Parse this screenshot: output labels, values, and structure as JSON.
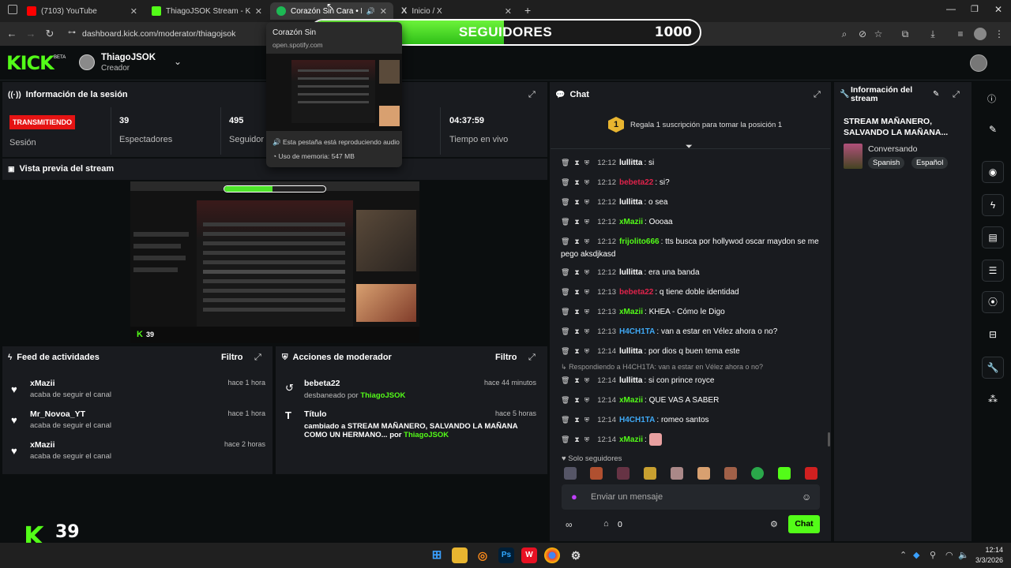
{
  "browser": {
    "tabs": [
      {
        "label": "(7103) YouTube",
        "color": "#ff0000"
      },
      {
        "label": "ThiagoJSOK Stream - Kick Dash",
        "color": "#53fc18"
      },
      {
        "label": "Corazón Sin Cara • Prince R",
        "color": "#1db954"
      },
      {
        "label": "Inicio / X",
        "color": "#ffffff"
      }
    ],
    "url": "dashboard.kick.com/moderator/thiagojsok"
  },
  "tab_preview": {
    "title": "Corazón Sin",
    "site": "open.spotify.com",
    "audio_note": "Esta pestaña está reproduciendo audio",
    "memory": "Uso de memoria: 547 MB"
  },
  "follower_goal": {
    "current": "495",
    "label": "SEGUIDORES",
    "target": "1000",
    "progress": 0.495
  },
  "header": {
    "logo": "KICK",
    "beta": "BETA",
    "username": "ThiagoJSOK",
    "role": "Creador"
  },
  "session": {
    "title": "Información de la sesión",
    "status": "TRANSMITIENDO",
    "status_label": "Sesión",
    "viewers_value": "39",
    "viewers_label": "Espectadores",
    "followers_value": "495",
    "followers_label": "Seguidor",
    "uptime_value": "04:37:59",
    "uptime_label": "Tiempo en vivo"
  },
  "preview": {
    "title": "Vista previa del stream"
  },
  "activity": {
    "title": "Feed de actividades",
    "filter": "Filtro",
    "items": [
      {
        "name": "xMazii",
        "sub": "acaba de seguir el canal",
        "time": "hace 1 hora"
      },
      {
        "name": "Mr_Novoa_YT",
        "sub": "acaba de seguir el canal",
        "time": "hace 1 hora"
      },
      {
        "name": "xMazii",
        "sub": "acaba de seguir el canal",
        "time": "hace 2 horas"
      }
    ]
  },
  "mod_actions": {
    "title": "Acciones de moderador",
    "filter": "Filtro",
    "items": [
      {
        "name": "bebeta22",
        "action": "desbaneado por",
        "by": "ThiagoJSOK",
        "time": "hace 44 minutos"
      },
      {
        "name": "Título",
        "action": "cambiado a STREAM MAÑANERO, SALVANDO LA MAÑANA COMO UN HERMANO... por",
        "by": "ThiagoJSOK",
        "time": "hace 5 horas"
      }
    ]
  },
  "chat": {
    "title": "Chat",
    "sub_promo": "Regala 1 suscripción para tomar la posición 1",
    "sub_rank": "1",
    "messages": [
      {
        "time": "12:12",
        "user": "lullitta",
        "color": "#ffffff",
        "text": "si"
      },
      {
        "time": "12:12",
        "user": "bebeta22",
        "color": "#e0234b",
        "text": "si?"
      },
      {
        "time": "12:12",
        "user": "lullitta",
        "color": "#ffffff",
        "text": "o sea"
      },
      {
        "time": "12:12",
        "user": "xMazii",
        "color": "#53fc18",
        "text": "Oooaa"
      },
      {
        "time": "12:12",
        "user": "frijolito666",
        "color": "#53fc18",
        "text": "tts busca por hollywod oscar maydon se me pego aksdjkasd"
      },
      {
        "time": "12:12",
        "user": "lullitta",
        "color": "#ffffff",
        "text": "era una banda"
      },
      {
        "time": "12:13",
        "user": "bebeta22",
        "color": "#e0234b",
        "text": "q tiene doble identidad"
      },
      {
        "time": "12:13",
        "user": "xMazii",
        "color": "#53fc18",
        "text": "KHEA - Cómo le Digo"
      },
      {
        "time": "12:13",
        "user": "H4CH1TA",
        "color": "#3fa9f5",
        "text": "van a estar en Vélez ahora o no?"
      },
      {
        "time": "12:14",
        "user": "lullitta",
        "color": "#ffffff",
        "text": "por dios q buen tema este"
      },
      {
        "time": "12:14",
        "user": "lullitta",
        "color": "#ffffff",
        "text": "si con prince royce"
      },
      {
        "time": "12:14",
        "user": "xMazii",
        "color": "#53fc18",
        "text": "QUE VAS A SABER"
      },
      {
        "time": "12:14",
        "user": "H4CH1TA",
        "color": "#3fa9f5",
        "text": "romeo santos"
      },
      {
        "time": "12:14",
        "user": "xMazii",
        "color": "#53fc18",
        "text": ""
      }
    ],
    "reply_note": "Respondiendo a H4CH1TA: van a estar en Vélez ahora o no?",
    "followers_only": "Solo seguidores",
    "placeholder": "Enviar un mensaje",
    "count_gift": "0",
    "send_label": "Chat"
  },
  "stream_info": {
    "title": "Información del stream",
    "stream_title": "STREAM MAÑANERO, SALVANDO LA MAÑANA...",
    "category": "Conversando",
    "tags": [
      "Spanish",
      "Español"
    ]
  },
  "overlay": {
    "logo": "K",
    "viewers": "39"
  },
  "taskbar": {
    "time": "12:14",
    "date": "3/3/2026"
  }
}
